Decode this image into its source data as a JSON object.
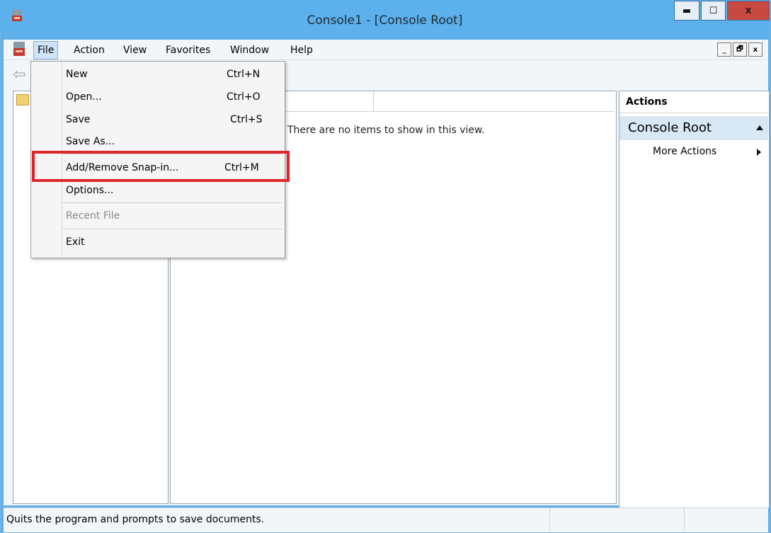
{
  "window": {
    "title": "Console1 - [Console Root]",
    "controls": {
      "minimize": "▬",
      "maximize": "☐",
      "close": "x"
    }
  },
  "menubar": {
    "items": [
      "File",
      "Action",
      "View",
      "Favorites",
      "Window",
      "Help"
    ],
    "mdi_controls": [
      "_",
      "🗗",
      "x"
    ]
  },
  "file_menu": {
    "items": [
      {
        "label": "New",
        "shortcut": "Ctrl+N",
        "enabled": true
      },
      {
        "label": "Open...",
        "shortcut": "Ctrl+O",
        "enabled": true
      },
      {
        "label": "Save",
        "shortcut": "Ctrl+S",
        "enabled": true
      },
      {
        "label": "Save As...",
        "shortcut": "",
        "enabled": true
      },
      {
        "label": "Add/Remove Snap-in...",
        "shortcut": "Ctrl+M",
        "enabled": true
      },
      {
        "label": "Options...",
        "shortcut": "",
        "enabled": true
      },
      {
        "label": "Recent File",
        "shortcut": "",
        "enabled": false
      },
      {
        "label": "Exit",
        "shortcut": "",
        "enabled": true
      }
    ]
  },
  "list_pane": {
    "empty_message": "There are no items to show in this view."
  },
  "actions_pane": {
    "header": "Actions",
    "section": "Console Root",
    "items": [
      "More Actions"
    ]
  },
  "statusbar": {
    "text": "Quits the program and prompts to save documents."
  },
  "colors": {
    "titlebar": "#5cb0ec",
    "highlight_box": "#e0242a",
    "close_button": "#c7483e"
  }
}
